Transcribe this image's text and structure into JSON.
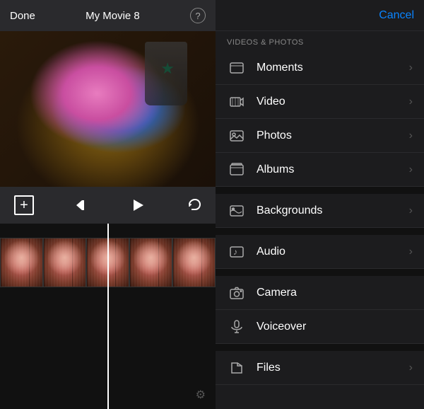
{
  "topBar": {
    "done": "Done",
    "title": "My Movie 8",
    "helpIcon": "?"
  },
  "controls": {
    "plusIcon": "+",
    "rewindIcon": "⏮",
    "playIcon": "▶",
    "undoIcon": "↩"
  },
  "rightPanel": {
    "cancelLabel": "Cancel",
    "sectionLabel": "VIDEOS & PHOTOS",
    "menuItems": [
      {
        "id": "moments",
        "label": "Moments",
        "icon": "moments"
      },
      {
        "id": "video",
        "label": "Video",
        "icon": "video"
      },
      {
        "id": "photos",
        "label": "Photos",
        "icon": "photos"
      },
      {
        "id": "albums",
        "label": "Albums",
        "icon": "albums"
      },
      {
        "id": "backgrounds",
        "label": "Backgrounds",
        "icon": "backgrounds"
      },
      {
        "id": "audio",
        "label": "Audio",
        "icon": "audio"
      },
      {
        "id": "camera",
        "label": "Camera",
        "icon": "camera"
      },
      {
        "id": "voiceover",
        "label": "Voiceover",
        "icon": "voiceover"
      },
      {
        "id": "files",
        "label": "Files",
        "icon": "files"
      }
    ],
    "settingsIcon": "⚙"
  }
}
